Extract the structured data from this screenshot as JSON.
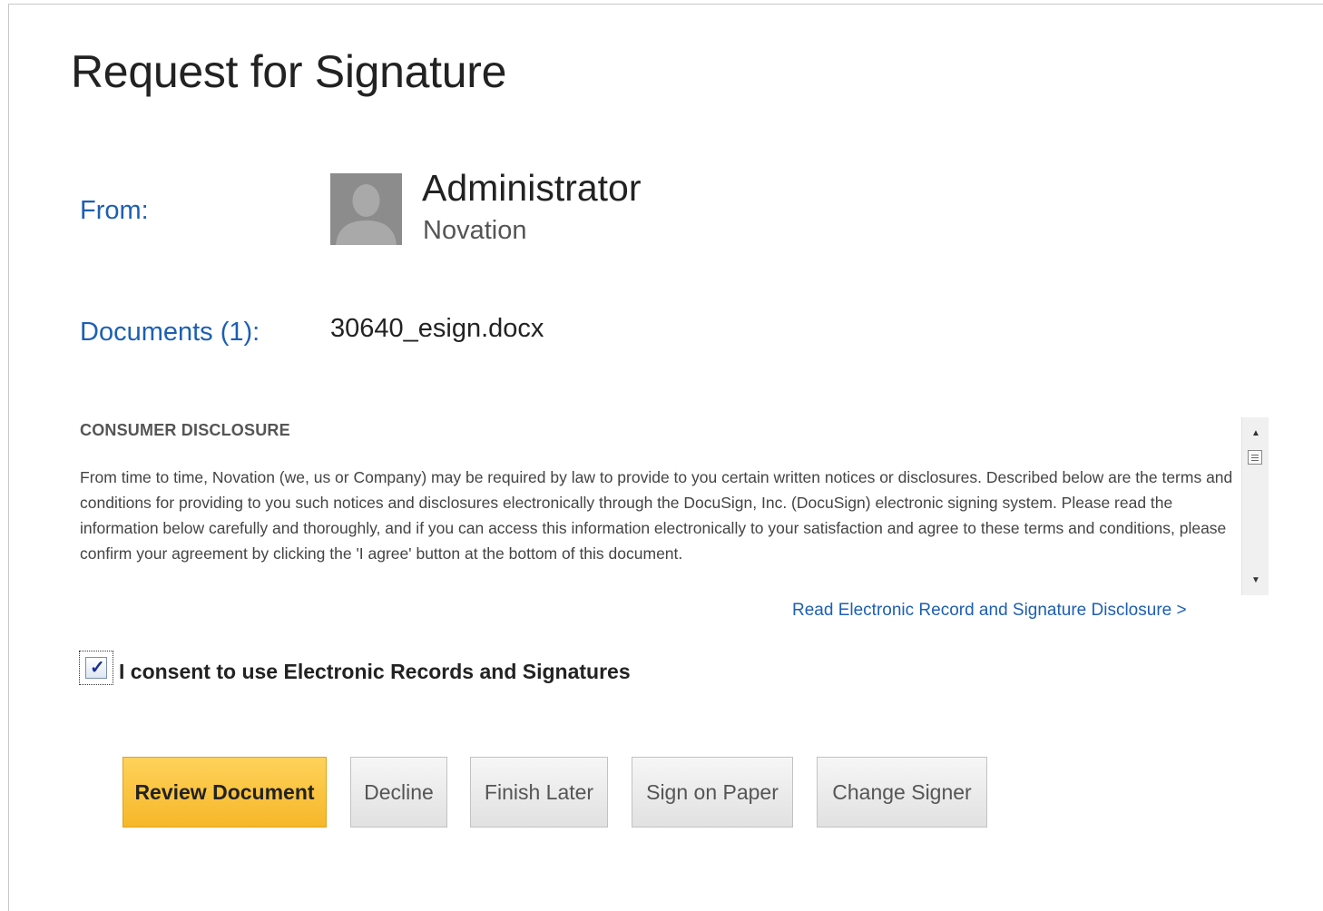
{
  "page": {
    "title": "Request for Signature"
  },
  "sender": {
    "label": "From:",
    "name": "Administrator",
    "organization": "Novation",
    "avatar_icon": "person-silhouette-icon"
  },
  "documents": {
    "label": "Documents (1):",
    "file_name": "30640_esign.docx"
  },
  "disclosure": {
    "heading": "CONSUMER DISCLOSURE",
    "body": "From time to time, Novation (we, us or Company) may be required by law to provide to you certain written notices or disclosures. Described below are the terms and conditions for providing to you such notices and disclosures electronically through the DocuSign, Inc. (DocuSign) electronic signing system. Please read the information below carefully and thoroughly, and if you can access this information electronically to your satisfaction and agree to these terms and conditions, please confirm your agreement by clicking the 'I agree' button at the bottom of this document.",
    "read_link": "Read Electronic Record and Signature Disclosure >",
    "scroll_up_icon": "arrow-up-icon",
    "scroll_down_icon": "arrow-down-icon"
  },
  "consent": {
    "label": "I consent to use Electronic Records and Signatures",
    "checked": true
  },
  "actions": {
    "review": "Review Document",
    "decline": "Decline",
    "finish_later": "Finish Later",
    "sign_on_paper": "Sign on Paper",
    "change_signer": "Change Signer"
  },
  "colors": {
    "link": "#1d5fb3",
    "primary_button": "#f6b72a"
  }
}
